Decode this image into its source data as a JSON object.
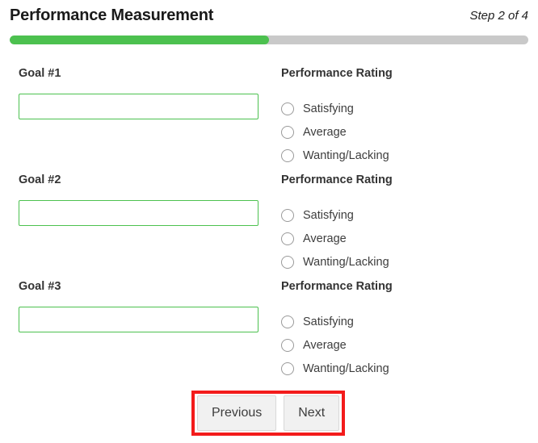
{
  "header": {
    "title": "Performance Measurement",
    "step_indicator": "Step 2 of 4"
  },
  "progress": {
    "percent": 50,
    "fill_color": "#4cc14f",
    "track_color": "#c9c9c9"
  },
  "form": {
    "rows": [
      {
        "goal_label": "Goal #1",
        "goal_value": "",
        "goal_placeholder": "",
        "rating_heading": "Performance Rating",
        "options": [
          "Satisfying",
          "Average",
          "Wanting/Lacking"
        ]
      },
      {
        "goal_label": "Goal #2",
        "goal_value": "",
        "goal_placeholder": "",
        "rating_heading": "Performance Rating",
        "options": [
          "Satisfying",
          "Average",
          "Wanting/Lacking"
        ]
      },
      {
        "goal_label": "Goal #3",
        "goal_value": "",
        "goal_placeholder": "",
        "rating_heading": "Performance Rating",
        "options": [
          "Satisfying",
          "Average",
          "Wanting/Lacking"
        ]
      }
    ]
  },
  "footer": {
    "previous_label": "Previous",
    "next_label": "Next",
    "annotation_color": "#f31b1b"
  }
}
